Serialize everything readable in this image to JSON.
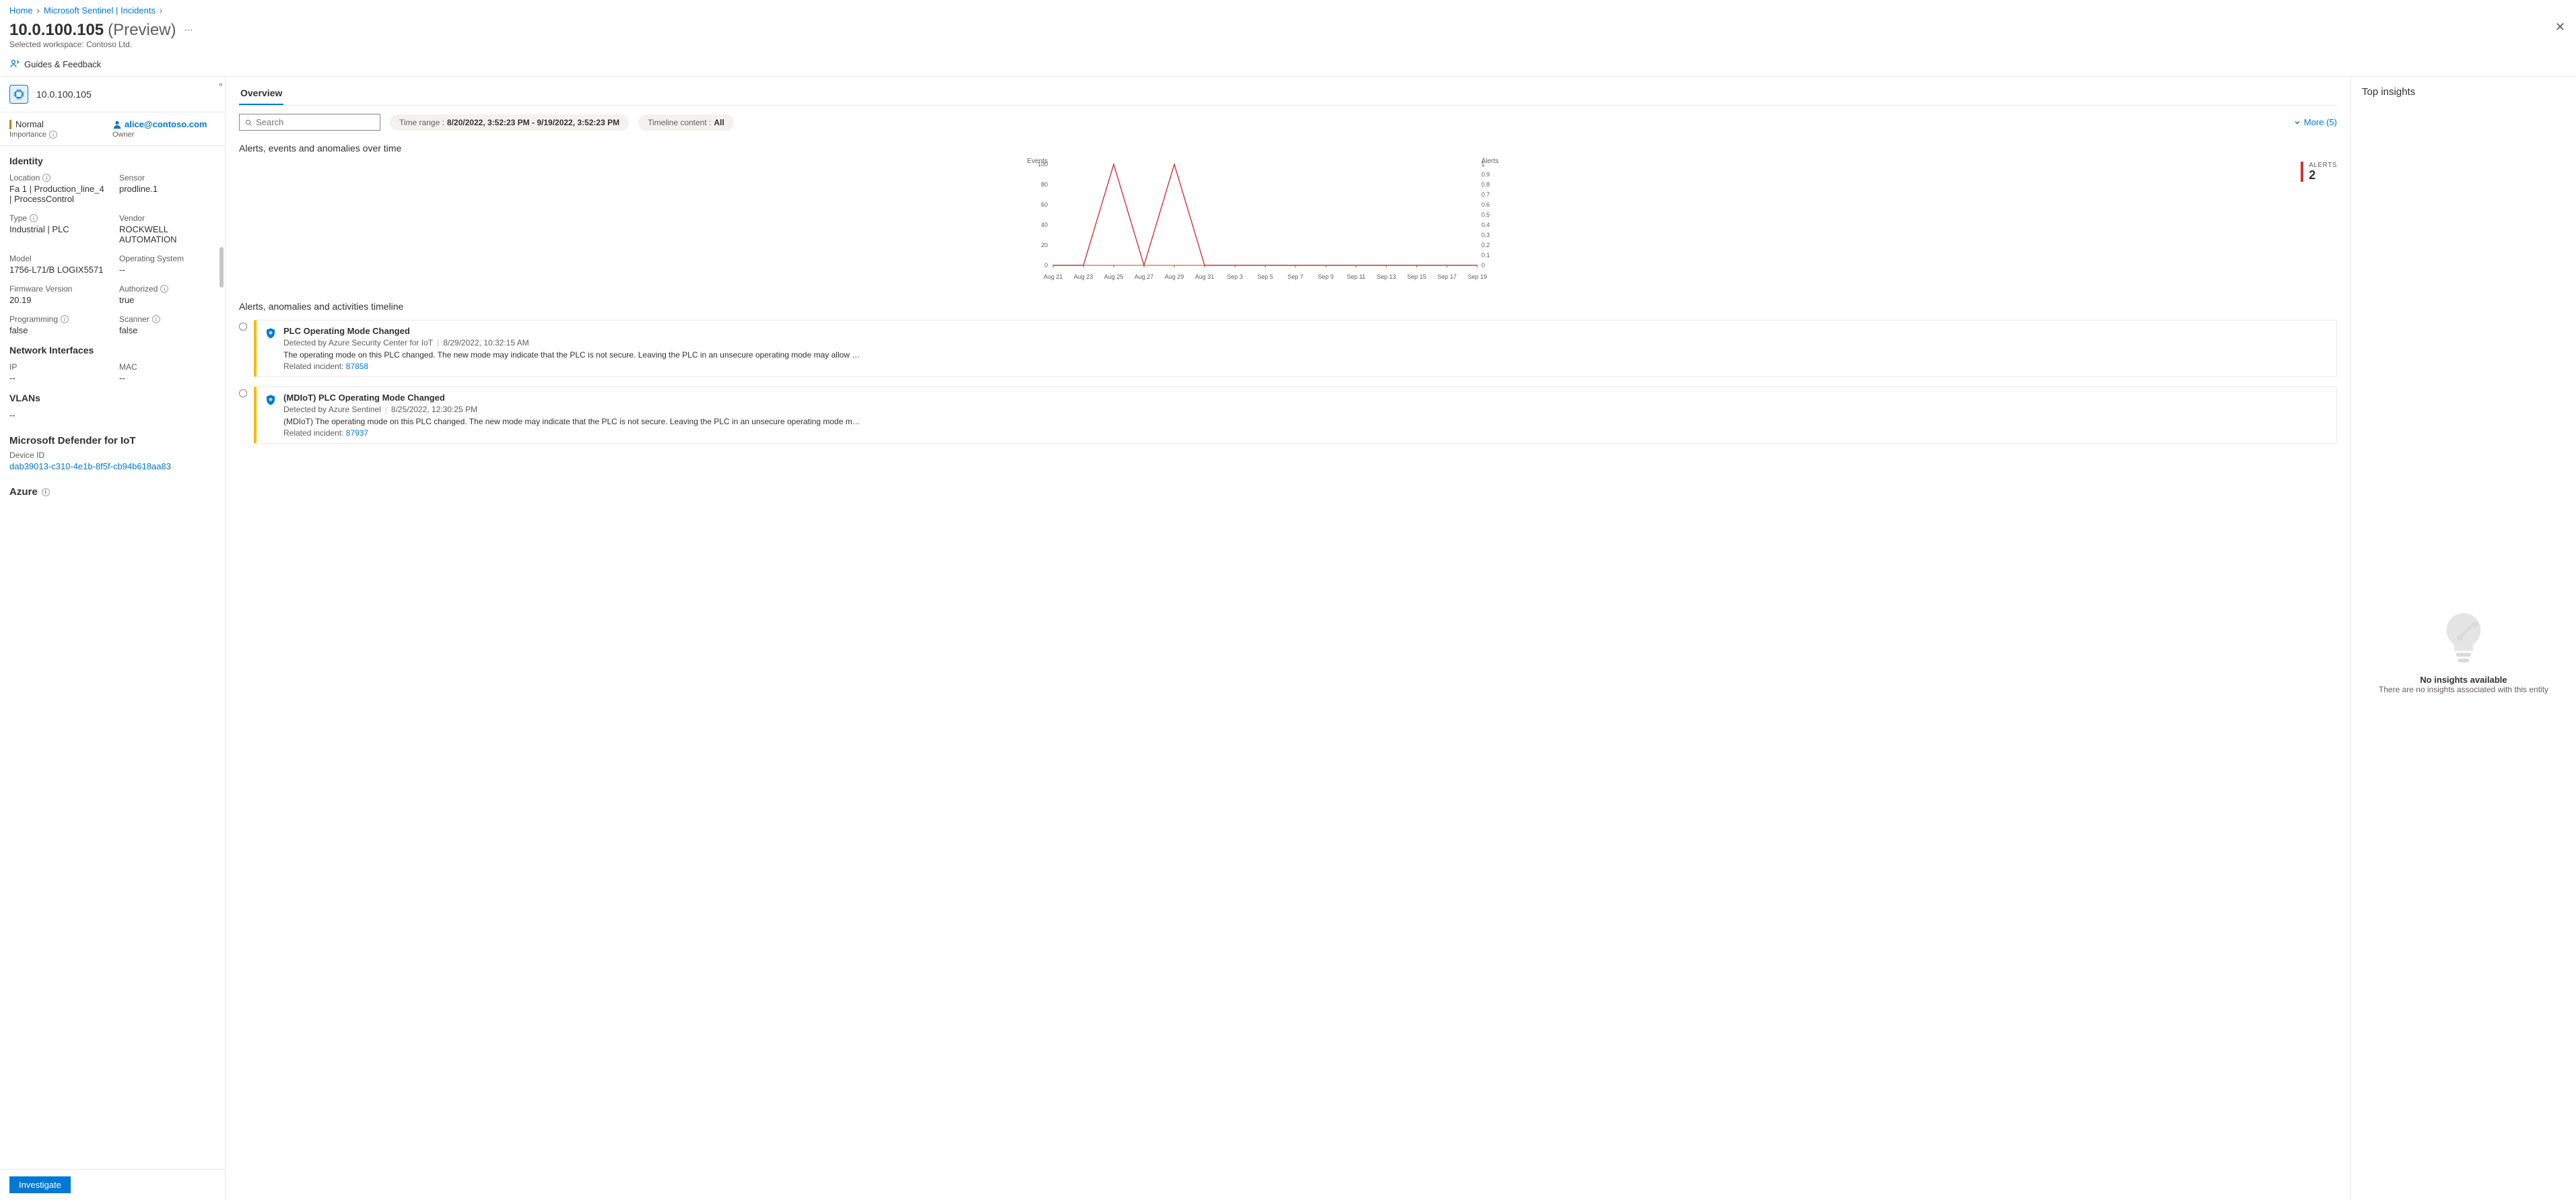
{
  "breadcrumb": {
    "home": "Home",
    "second": "Microsoft Sentinel | Incidents"
  },
  "page": {
    "title": "10.0.100.105",
    "suffix": "(Preview)",
    "workspace_label": "Selected workspace:",
    "workspace": "Contoso Ltd."
  },
  "guides": "Guides & Feedback",
  "entity": {
    "ip": "10.0.100.105"
  },
  "importance": {
    "level": "Normal",
    "label": "Importance"
  },
  "owner": {
    "email": "alice@contoso.com",
    "label": "Owner"
  },
  "identity": {
    "heading": "Identity",
    "location_label": "Location",
    "location_value": "Fa 1 | Production_line_4 | ProcessControl",
    "sensor_label": "Sensor",
    "sensor_value": "prodline.1",
    "type_label": "Type",
    "type_value": "Industrial | PLC",
    "vendor_label": "Vendor",
    "vendor_value": "ROCKWELL AUTOMATION",
    "model_label": "Model",
    "model_value": "1756-L71/B LOGIX5571",
    "os_label": "Operating System",
    "os_value": "--",
    "fw_label": "Firmware Version",
    "fw_value": "20.19",
    "auth_label": "Authorized",
    "auth_value": "true",
    "prog_label": "Programming",
    "prog_value": "false",
    "scanner_label": "Scanner",
    "scanner_value": "false"
  },
  "network": {
    "heading": "Network Interfaces",
    "ip_label": "IP",
    "ip_value": "--",
    "mac_label": "MAC",
    "mac_value": "--"
  },
  "vlans": {
    "heading": "VLANs",
    "value": "--"
  },
  "defender": {
    "heading": "Microsoft Defender for IoT",
    "device_id_label": "Device ID",
    "device_id": "dab39013-c310-4e1b-8f5f-cb94b618aa83"
  },
  "azure": {
    "heading": "Azure"
  },
  "investigate": "Investigate",
  "overview": {
    "tab": "Overview",
    "search_placeholder": "Search",
    "time_range_label": "Time range :",
    "time_range_value": "8/20/2022, 3:52:23 PM - 9/19/2022, 3:52:23 PM",
    "timeline_content_label": "Timeline content :",
    "timeline_content_value": "All",
    "more": "More (5)"
  },
  "chart": {
    "title": "Alerts, events and anomalies over time",
    "events_label": "Events",
    "alerts_label": "Alerts",
    "alerts_kpi_label": "ALERTS",
    "alerts_kpi_value": "2"
  },
  "timeline": {
    "heading": "Alerts, anomalies and activities timeline",
    "items": [
      {
        "title": "PLC Operating Mode Changed",
        "source": "Detected by Azure Security Center for IoT",
        "time": "8/29/2022, 10:32:15 AM",
        "desc": "The operating mode on this PLC changed. The new mode may indicate that the PLC is not secure. Leaving the PLC in an unsecure operating mode may allow …",
        "related_label": "Related incident:",
        "related_link": "87858"
      },
      {
        "title": "(MDIoT) PLC Operating Mode Changed",
        "source": "Detected by Azure Sentinel",
        "time": "8/25/2022, 12:30:25 PM",
        "desc": "(MDIoT) The operating mode on this PLC changed. The new mode may indicate that the PLC is not secure. Leaving the PLC in an unsecure operating mode m…",
        "related_label": "Related incident:",
        "related_link": "87937"
      }
    ]
  },
  "insights": {
    "heading": "Top insights",
    "empty_title": "No insights available",
    "empty_sub": "There are no insights associated with this entity"
  },
  "chart_data": {
    "type": "line",
    "title": "Alerts, events and anomalies over time",
    "x_axis_label": "Events",
    "y_left_label": "Events",
    "y_right_label": "Alerts",
    "y_left_ticks": [
      0,
      20,
      40,
      60,
      80,
      100
    ],
    "y_right_ticks": [
      0,
      0.1,
      0.2,
      0.3,
      0.4,
      0.5,
      0.6,
      0.7,
      0.8,
      0.9,
      1
    ],
    "categories": [
      "Aug 21",
      "Aug 23",
      "Aug 25",
      "Aug 27",
      "Aug 29",
      "Aug 31",
      "Sep 3",
      "Sep 5",
      "Sep 7",
      "Sep 9",
      "Sep 11",
      "Sep 13",
      "Sep 15",
      "Sep 17",
      "Sep 19"
    ],
    "series": [
      {
        "name": "Events",
        "axis": "left",
        "color": "#d13438",
        "values": [
          0,
          0,
          100,
          0,
          100,
          0,
          0,
          0,
          0,
          0,
          0,
          0,
          0,
          0,
          0
        ]
      }
    ],
    "ylim_left": [
      0,
      100
    ],
    "ylim_right": [
      0,
      1
    ]
  }
}
